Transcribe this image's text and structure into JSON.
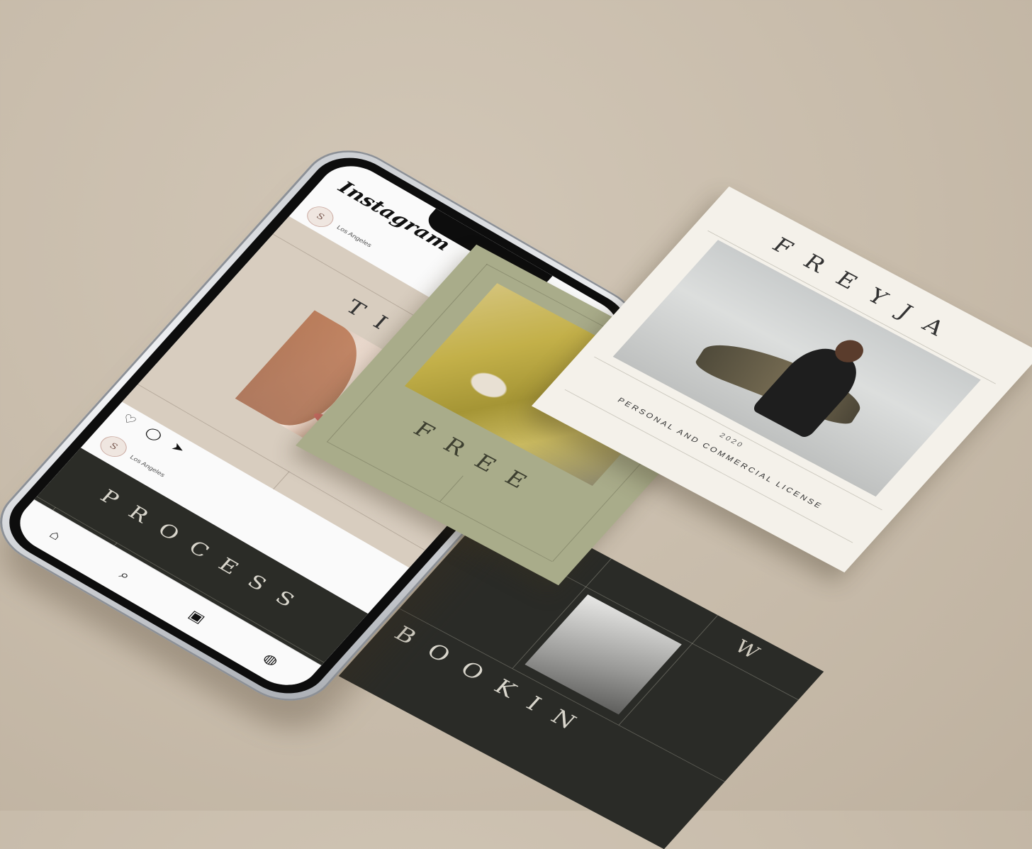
{
  "instagram": {
    "logo": "Instagram",
    "actions": {
      "new_post_icon": "⊞",
      "heart_icon": "♡",
      "send_icon": "➤"
    },
    "post1": {
      "avatar_letter": "S",
      "location": "Los Angeles",
      "title": "TIPS"
    },
    "post1_actions": {
      "like": "♡",
      "comment": "◯",
      "share": "➤"
    },
    "post2": {
      "avatar_letter": "S",
      "location": "Los Angeles",
      "title": "PROCESS"
    },
    "tabbar": {
      "home": "⌂",
      "search": "⌕",
      "reels": "▣",
      "shop": "◍"
    }
  },
  "cards": {
    "free": {
      "title": "FREE"
    },
    "freyja": {
      "title": "FREYJA",
      "subtitle": "2020",
      "license": "PERSONAL AND COMMERCIAL LICENSE"
    },
    "booking": {
      "title": "BOOKIN",
      "top_letter": "W"
    }
  },
  "colors": {
    "background": "#c8bcab",
    "post1_bg": "#d8cdbf",
    "dark_card": "#2a2b27",
    "green_card": "#a9ac8a",
    "cream_card": "#f4f1ea"
  }
}
